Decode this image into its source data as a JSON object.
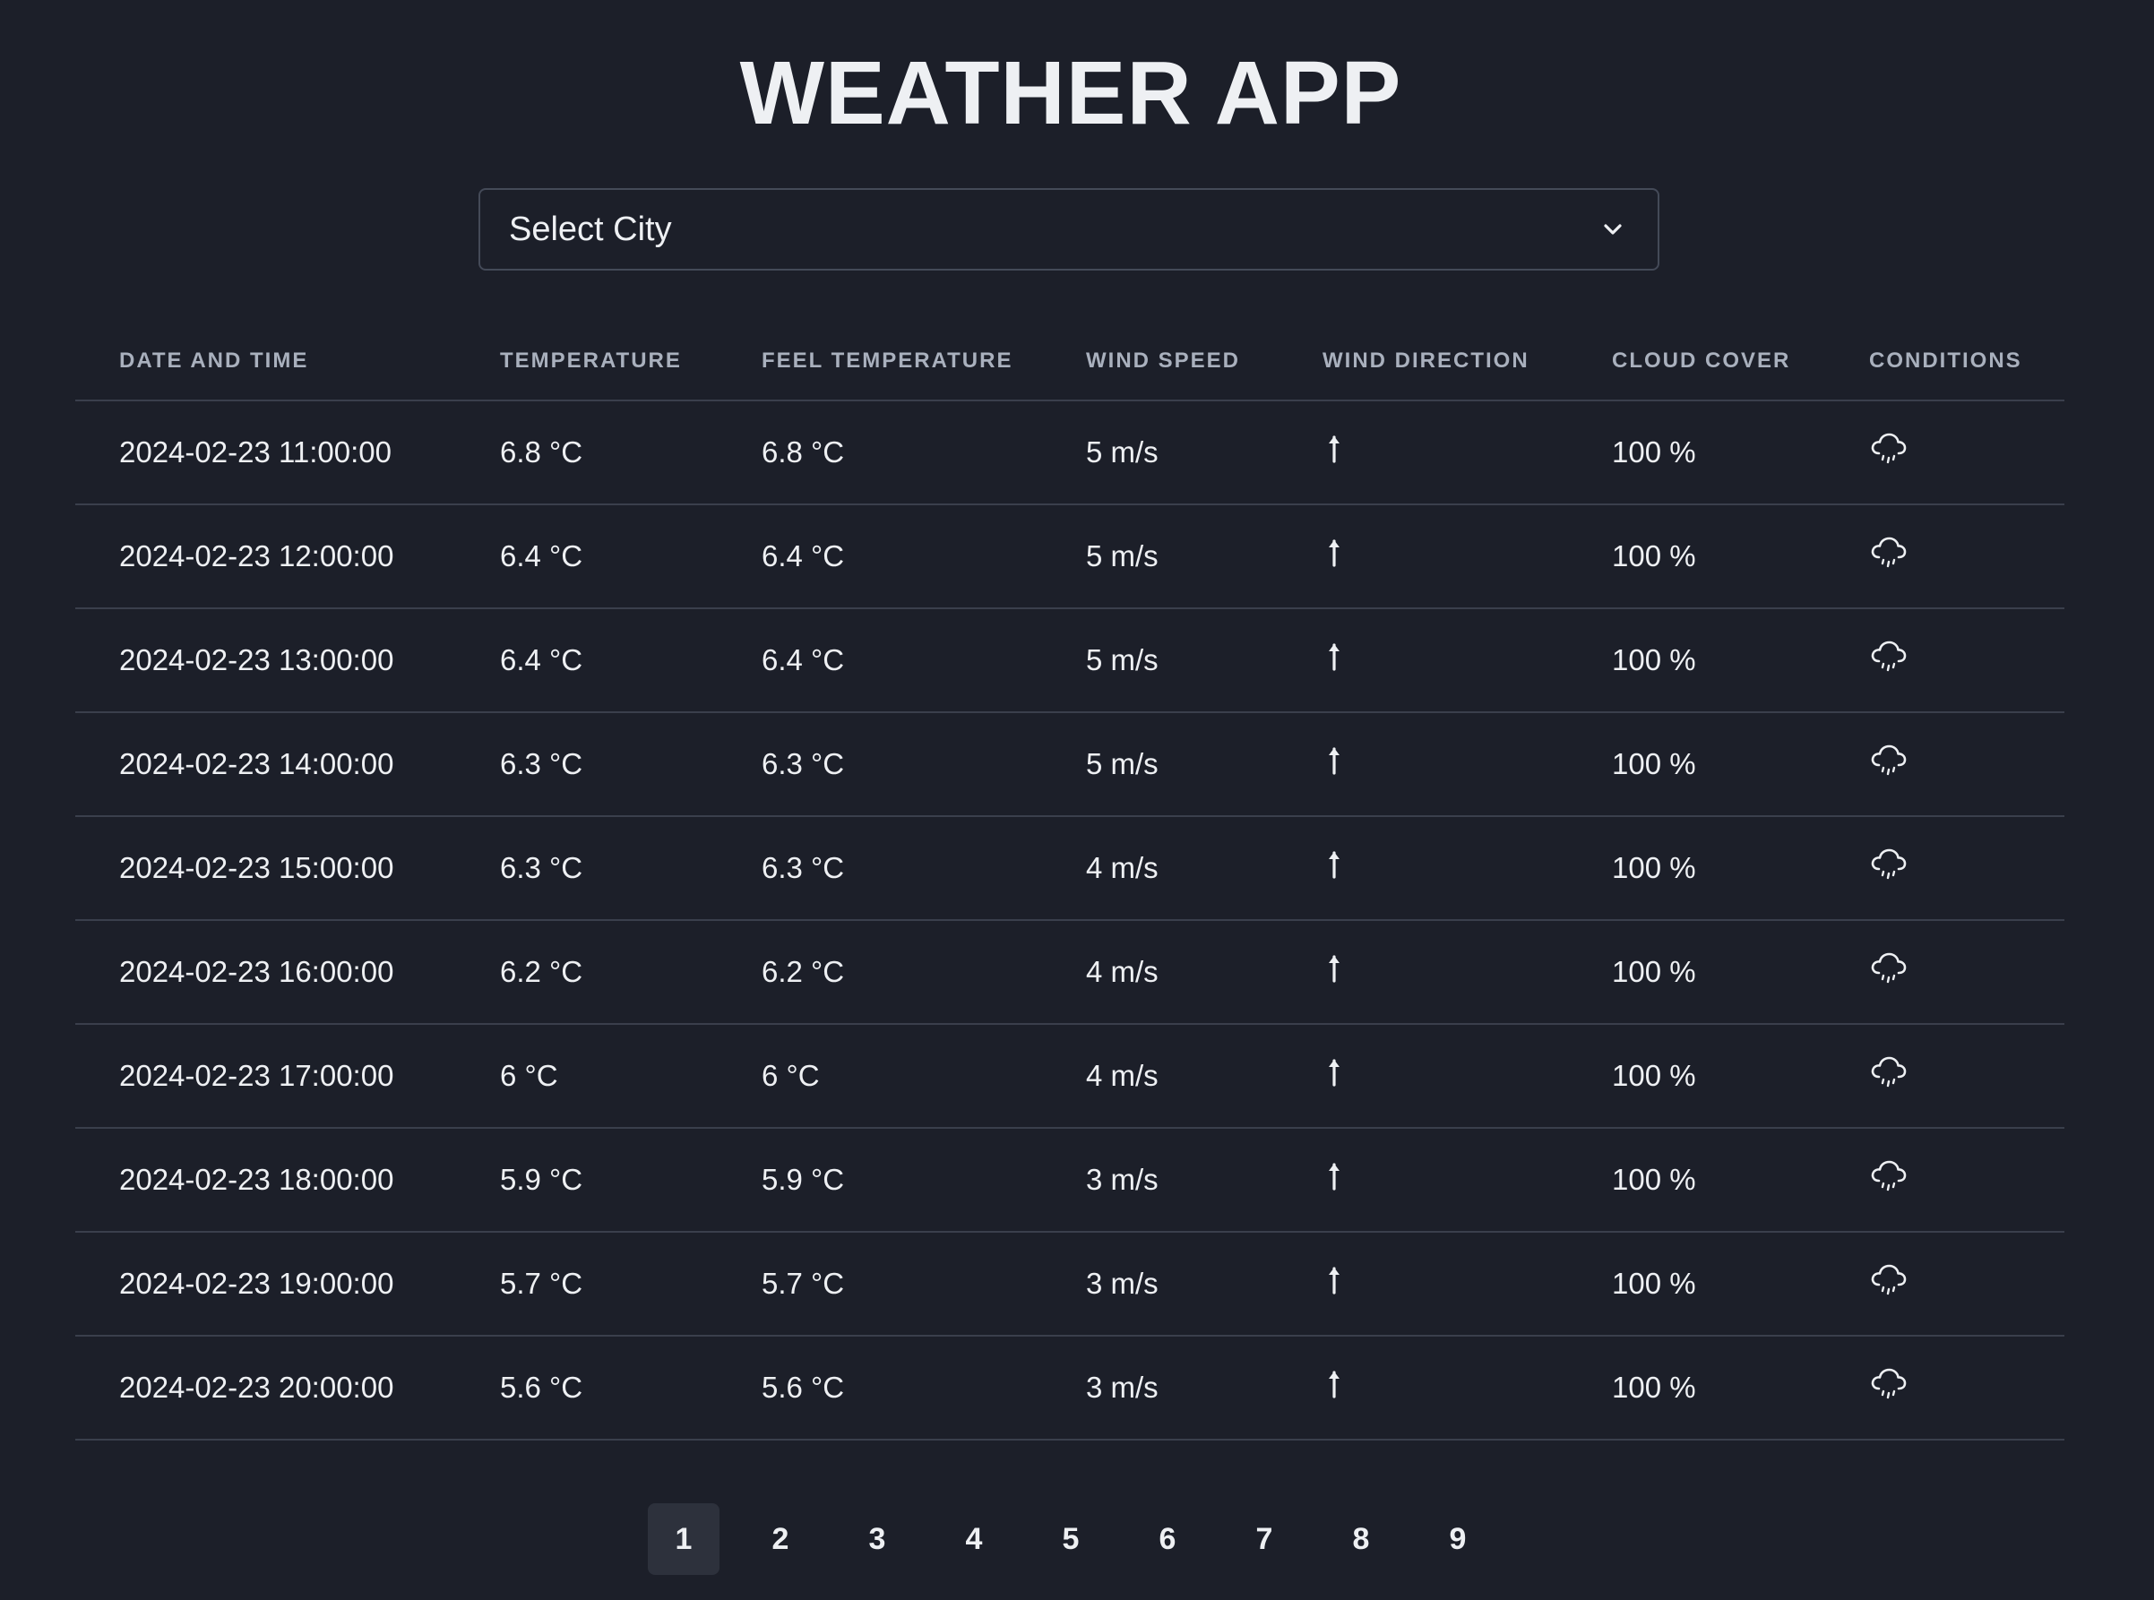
{
  "app": {
    "title": "WEATHER APP"
  },
  "city_select": {
    "value": "Select City",
    "icon": "chevron-down-icon"
  },
  "table": {
    "headers": [
      "DATE AND TIME",
      "TEMPERATURE",
      "FEEL TEMPERATURE",
      "WIND SPEED",
      "WIND DIRECTION",
      "CLOUD COVER",
      "CONDITIONS"
    ],
    "rows": [
      {
        "datetime": "2024-02-23 11:00:00",
        "temp": "6.8 °C",
        "feel": "6.8 °C",
        "wind_speed": "5 m/s",
        "wind_dir_icon": "arrow-up-icon",
        "cloud": "100 %",
        "condition_icon": "cloud-rain-icon"
      },
      {
        "datetime": "2024-02-23 12:00:00",
        "temp": "6.4 °C",
        "feel": "6.4 °C",
        "wind_speed": "5 m/s",
        "wind_dir_icon": "arrow-up-icon",
        "cloud": "100 %",
        "condition_icon": "cloud-rain-icon"
      },
      {
        "datetime": "2024-02-23 13:00:00",
        "temp": "6.4 °C",
        "feel": "6.4 °C",
        "wind_speed": "5 m/s",
        "wind_dir_icon": "arrow-up-icon",
        "cloud": "100 %",
        "condition_icon": "cloud-rain-icon"
      },
      {
        "datetime": "2024-02-23 14:00:00",
        "temp": "6.3 °C",
        "feel": "6.3 °C",
        "wind_speed": "5 m/s",
        "wind_dir_icon": "arrow-up-icon",
        "cloud": "100 %",
        "condition_icon": "cloud-rain-icon"
      },
      {
        "datetime": "2024-02-23 15:00:00",
        "temp": "6.3 °C",
        "feel": "6.3 °C",
        "wind_speed": "4 m/s",
        "wind_dir_icon": "arrow-up-icon",
        "cloud": "100 %",
        "condition_icon": "cloud-rain-icon"
      },
      {
        "datetime": "2024-02-23 16:00:00",
        "temp": "6.2 °C",
        "feel": "6.2 °C",
        "wind_speed": "4 m/s",
        "wind_dir_icon": "arrow-up-icon",
        "cloud": "100 %",
        "condition_icon": "cloud-rain-icon"
      },
      {
        "datetime": "2024-02-23 17:00:00",
        "temp": "6 °C",
        "feel": "6 °C",
        "wind_speed": "4 m/s",
        "wind_dir_icon": "arrow-up-icon",
        "cloud": "100 %",
        "condition_icon": "cloud-rain-icon"
      },
      {
        "datetime": "2024-02-23 18:00:00",
        "temp": "5.9 °C",
        "feel": "5.9 °C",
        "wind_speed": "3 m/s",
        "wind_dir_icon": "arrow-up-icon",
        "cloud": "100 %",
        "condition_icon": "cloud-rain-icon"
      },
      {
        "datetime": "2024-02-23 19:00:00",
        "temp": "5.7 °C",
        "feel": "5.7 °C",
        "wind_speed": "3 m/s",
        "wind_dir_icon": "arrow-up-icon",
        "cloud": "100 %",
        "condition_icon": "cloud-rain-icon"
      },
      {
        "datetime": "2024-02-23 20:00:00",
        "temp": "5.6 °C",
        "feel": "5.6 °C",
        "wind_speed": "3 m/s",
        "wind_dir_icon": "arrow-up-icon",
        "cloud": "100 %",
        "condition_icon": "cloud-rain-icon"
      }
    ]
  },
  "pagination": {
    "pages": [
      "1",
      "2",
      "3",
      "4",
      "5",
      "6",
      "7",
      "8",
      "9"
    ],
    "current": "1"
  },
  "colors": {
    "background": "#1c1f29",
    "text": "#eef0f3",
    "header_text": "#a9b0bd",
    "divider": "#3a3f4c",
    "active_page_bg": "#2d313c"
  }
}
